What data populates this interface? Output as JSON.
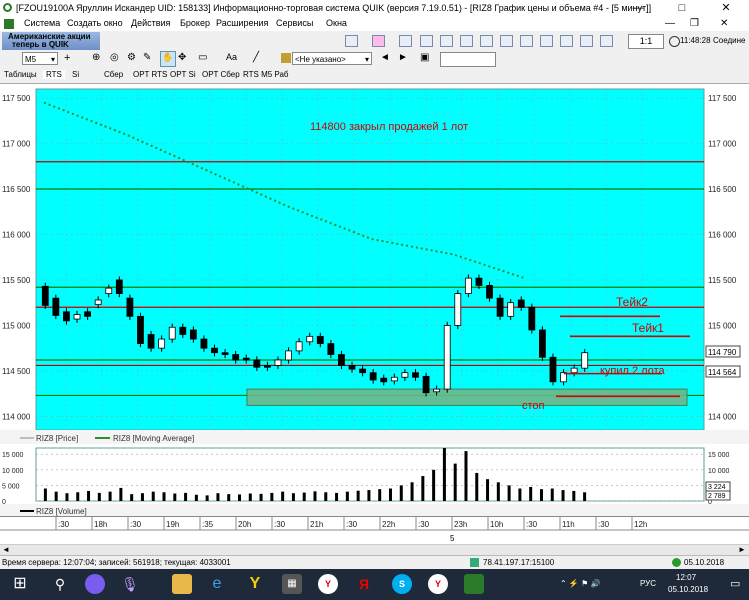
{
  "window": {
    "title": "[FZOU19100A Яруллин Искандер UID: 158133] Информационно-торговая система QUIK (версия 7.19.0.51) - [RIZ8 График цены и объема #4 - [5 минут]]",
    "minimize": "—",
    "maximize": "□",
    "close": "✕"
  },
  "menu": [
    "Система",
    "Создать окно",
    "Действия",
    "Брокер",
    "Расширения",
    "Сервисы",
    "Окна"
  ],
  "toolbar": {
    "ad_line1": "Американские акции",
    "ad_line2": "теперь в QUIK",
    "ratio": "1:1",
    "time": "11:48:28",
    "connection": "Соедине"
  },
  "toolbar2": {
    "interval": "M5",
    "font_btn": "Aa",
    "instrument_select": "<Не указано>"
  },
  "tabs": [
    "Таблицы",
    "RTS",
    "Si",
    "Сбер",
    "OPT RTS",
    "OPT Si",
    "OPT Сбер",
    "RTS M5 Раб"
  ],
  "price_chart": {
    "y_ticks": [
      "117 500",
      "117 000",
      "116 500",
      "116 000",
      "115 500",
      "115 000",
      "114 500",
      "114 000"
    ],
    "annotations": {
      "main": "114800 закрыл продажей 1 лот",
      "take2": "Тейк2",
      "take1": "Тейк1",
      "buy": "купил 2 лота",
      "stop": "стоп"
    },
    "price_labels": [
      "114 790",
      "114 564"
    ],
    "legend": [
      "RIZ8 [Price]",
      "RIZ8 [Moving Average]"
    ]
  },
  "volume_chart": {
    "y_ticks": [
      "15 000",
      "10 000",
      "5 000",
      "0"
    ],
    "right_ticks": [
      "15 000",
      "10 000",
      "5 000",
      "0"
    ],
    "last_labels": [
      "3 224",
      "2 789"
    ],
    "legend": "RIZ8 [Volume]"
  },
  "time_axis": {
    "labels": [
      ":30",
      "18h",
      ":30",
      "19h",
      ":35",
      "20h",
      ":30",
      "21h",
      ":30",
      "22h",
      ":30",
      "23h",
      "10h",
      ":30",
      "11h",
      ":30",
      "12h"
    ],
    "day_label": "5"
  },
  "status": {
    "server_time": "Время сервера: 12:07:04; записей: 561918; текущая: 4033001",
    "ip": "78.41.197.17:15100",
    "date": "05.10.2018"
  },
  "taskbar": {
    "lang": "РУС",
    "clock_time": "12:07",
    "clock_date": "05.10.2018"
  },
  "colors": {
    "chart_bg": "#00ffff",
    "green_line": "#008000",
    "red_line": "#c00000",
    "ma_line": "#2e8b2e",
    "annotation_red": "#d00000"
  },
  "chart_data": {
    "type": "candlestick",
    "title": "RIZ8",
    "ylim": [
      113850,
      117600
    ],
    "horizontal_levels": {
      "green": [
        116500,
        115420,
        114620,
        114230
      ],
      "red": [
        116800,
        115200,
        114560
      ],
      "highlight_band": [
        114120,
        114300
      ]
    },
    "moving_average": [
      [
        0,
        117450
      ],
      [
        0.15,
        117100
      ],
      [
        0.3,
        116700
      ],
      [
        0.45,
        116300
      ],
      [
        0.6,
        115950
      ],
      [
        0.75,
        115780
      ],
      [
        0.88,
        115520
      ]
    ],
    "candles": [
      [
        115430,
        115220
      ],
      [
        115300,
        115110
      ],
      [
        115150,
        115050
      ],
      [
        115070,
        115120
      ],
      [
        115150,
        115100
      ],
      [
        115230,
        115280
      ],
      [
        115350,
        115410
      ],
      [
        115500,
        115350
      ],
      [
        115300,
        115100
      ],
      [
        115100,
        114800
      ],
      [
        114900,
        114750
      ],
      [
        114750,
        114850
      ],
      [
        114850,
        114980
      ],
      [
        114980,
        114900
      ],
      [
        114950,
        114850
      ],
      [
        114850,
        114750
      ],
      [
        114750,
        114700
      ],
      [
        114700,
        114680
      ],
      [
        114680,
        114620
      ],
      [
        114640,
        114620
      ],
      [
        114620,
        114540
      ],
      [
        114560,
        114540
      ],
      [
        114560,
        114620
      ],
      [
        114620,
        114720
      ],
      [
        114720,
        114820
      ],
      [
        114820,
        114880
      ],
      [
        114880,
        114800
      ],
      [
        114800,
        114680
      ],
      [
        114680,
        114560
      ],
      [
        114560,
        114520
      ],
      [
        114520,
        114480
      ],
      [
        114480,
        114400
      ],
      [
        114420,
        114380
      ],
      [
        114390,
        114430
      ],
      [
        114430,
        114480
      ],
      [
        114480,
        114430
      ],
      [
        114440,
        114260
      ],
      [
        114270,
        114300
      ],
      [
        114300,
        115000
      ],
      [
        115000,
        115350
      ],
      [
        115350,
        115520
      ],
      [
        115520,
        115440
      ],
      [
        115440,
        115300
      ],
      [
        115300,
        115100
      ],
      [
        115100,
        115250
      ],
      [
        115280,
        115200
      ],
      [
        115200,
        114950
      ],
      [
        114950,
        114650
      ],
      [
        114650,
        114380
      ],
      [
        114380,
        114480
      ],
      [
        114480,
        114530
      ],
      [
        114530,
        114700
      ]
    ],
    "volume": [
      4000,
      3000,
      2500,
      2800,
      3200,
      2600,
      3000,
      4200,
      2200,
      2500,
      3000,
      2800,
      2400,
      2600,
      2000,
      1800,
      2500,
      2200,
      2100,
      2400,
      2300,
      2600,
      3000,
      2500,
      2700,
      3100,
      2800,
      2600,
      3000,
      3300,
      3500,
      3800,
      4000,
      5000,
      6000,
      8000,
      10000,
      17000,
      12000,
      16000,
      9000,
      7000,
      6000,
      5000,
      4000,
      4500,
      3800,
      4000,
      3500,
      3224,
      2789
    ],
    "x_tick_labels": [
      ":30",
      "18h",
      ":30",
      "19h",
      ":35",
      "20h",
      ":30",
      "21h",
      ":30",
      "22h",
      ":30",
      "23h",
      "10h",
      ":30",
      "11h",
      ":30",
      "12h"
    ]
  }
}
